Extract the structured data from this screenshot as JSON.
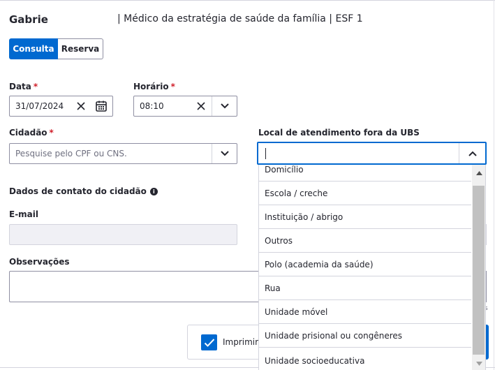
{
  "professional": {
    "name": "Gabrie",
    "role": "| Médico da estratégia de saúde da família | ESF 1"
  },
  "mode_toggle": {
    "options": [
      "Consulta",
      "Reserva"
    ],
    "selected": "Consulta"
  },
  "form": {
    "date": {
      "label": "Data",
      "required_mark": "*",
      "value": "31/07/2024"
    },
    "time": {
      "label": "Horário",
      "required_mark": "*",
      "value": "08:10"
    },
    "citizen": {
      "label": "Cidadão",
      "required_mark": "*",
      "placeholder": "Pesquise pelo CPF ou CNS."
    },
    "location": {
      "label": "Local de atendimento fora da UBS",
      "value": "",
      "options": [
        "Domicílio",
        "Escola / creche",
        "Instituição / abrigo",
        "Outros",
        "Polo (academia da saúde)",
        "Rua",
        "Unidade móvel",
        "Unidade prisional ou congêneres",
        "Unidade socioeducativa"
      ]
    },
    "contact_section": {
      "title": "Dados de contato do cidadão"
    },
    "email": {
      "label": "E-mail",
      "value": ""
    },
    "notes": {
      "label": "Observações",
      "value": ""
    },
    "print_checkbox": {
      "label": "Imprimir",
      "checked": true
    }
  },
  "colors": {
    "primary": "#0069d0",
    "required": "#d01e29",
    "text": "#24252e",
    "border": "#8f8fa2"
  }
}
